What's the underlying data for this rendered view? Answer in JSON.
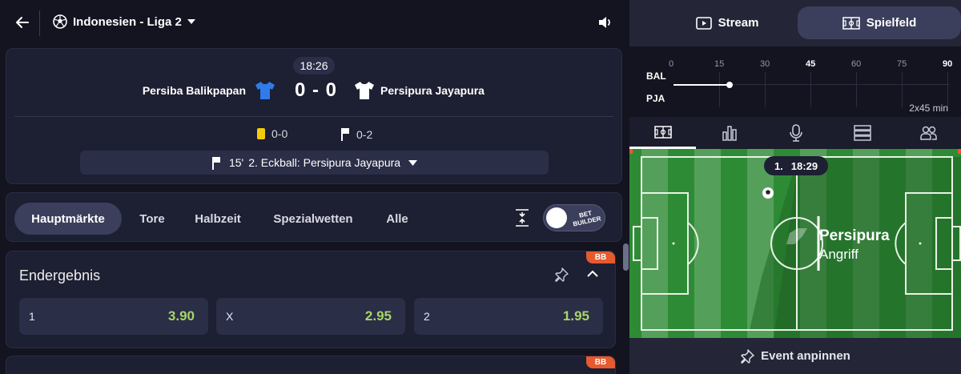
{
  "header": {
    "league": "Indonesien - Liga 2"
  },
  "match": {
    "clock": "18:26",
    "home_team": "Persiba Balikpapan",
    "away_team": "Persipura Jayapura",
    "score": "0 - 0",
    "yellow_cards": "0-0",
    "corners": "0-2",
    "last_event_minute": "15'",
    "last_event_text": "2. Eckball: Persipura Jayapura",
    "home_shirt_color": "#2f7be8",
    "away_shirt_color": "#ffffff"
  },
  "market_tabs": [
    "Hauptmärkte",
    "Tore",
    "Halbzeit",
    "Spezialwetten",
    "Alle"
  ],
  "bet_builder_label": "BET BUILDER",
  "markets": [
    {
      "badge": "BB",
      "title": "Endergebnis",
      "odds": [
        {
          "label": "1",
          "value": "3.90"
        },
        {
          "label": "X",
          "value": "2.95"
        },
        {
          "label": "2",
          "value": "1.95"
        }
      ]
    },
    {
      "badge": "BB"
    }
  ],
  "right_panel": {
    "stream_label": "Stream",
    "field_label": "Spielfeld",
    "timeline": {
      "ticks": [
        "0",
        "15",
        "30",
        "45",
        "60",
        "75",
        "90"
      ],
      "teams": [
        "BAL",
        "PJA"
      ],
      "period_label": "2x45 min",
      "progress_minutes": 18.5
    },
    "pitch": {
      "half": "1.",
      "clock": "18:29",
      "team": "Persipura",
      "action": "Angriff"
    },
    "pin_label": "Event anpinnen"
  },
  "colors": {
    "accent_green": "#a8d468",
    "badge_orange": "#e65a2e",
    "pitch_green": "#2e8b35",
    "yellow_card": "#f2cc0c"
  }
}
